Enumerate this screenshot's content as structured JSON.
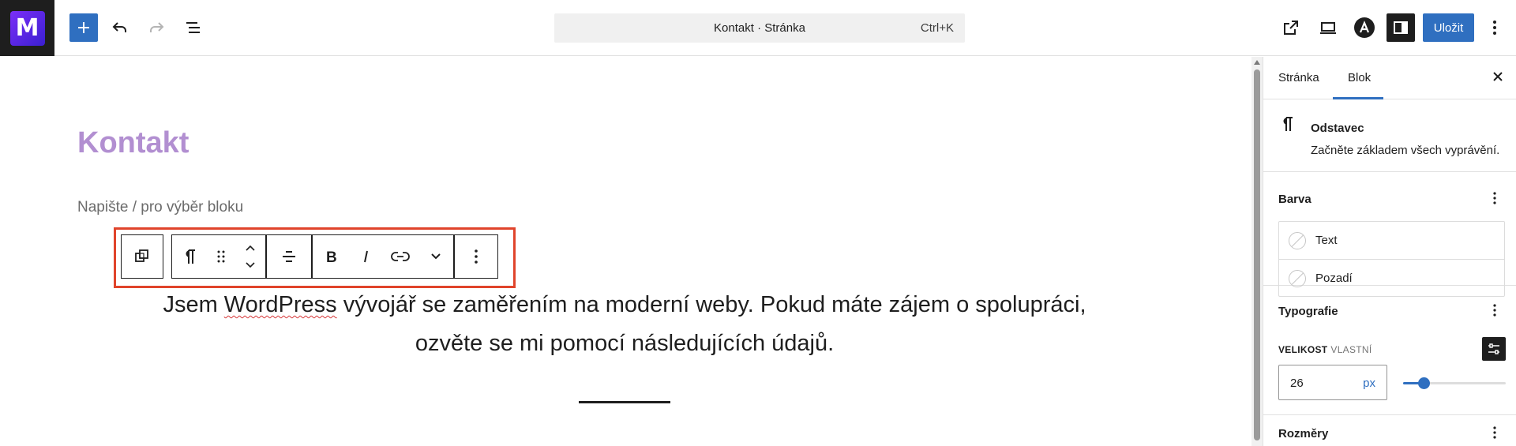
{
  "app": {
    "logo_letter": "M"
  },
  "header": {
    "command_title": "Kontakt · Stránka",
    "command_shortcut": "Ctrl+K",
    "save_label": "Uložit"
  },
  "editor": {
    "page_title": "Kontakt",
    "placeholder": "Napište / pro výběr bloku",
    "paragraph": {
      "part1": "Jsem ",
      "misspelled": "WordPress",
      "part2": " vývojář se zaměřením na moderní weby. Pokud máte zájem o spolupráci, ozvěte se mi pomocí následujících údajů."
    }
  },
  "sidebar": {
    "tabs": [
      {
        "label": "Stránka"
      },
      {
        "label": "Blok"
      }
    ],
    "active_tab": "Blok",
    "block": {
      "name": "Odstavec",
      "description": "Začněte základem všech vyprávění."
    },
    "color_panel": {
      "title": "Barva",
      "items": [
        {
          "label": "Text"
        },
        {
          "label": "Pozadí"
        }
      ]
    },
    "typography_panel": {
      "title": "Typografie",
      "size_label": "VELIKOST",
      "size_mode": "VLASTNÍ",
      "size_value": "26",
      "size_unit": "px",
      "slider_fraction": 0.2
    },
    "next_panel_title": "Rozměry"
  },
  "colors": {
    "accent": "#2f6fc0",
    "title": "#b28fd1",
    "highlight_frame": "#e0442b"
  }
}
